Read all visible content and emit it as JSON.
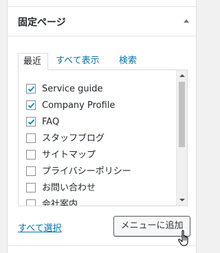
{
  "metabox": {
    "title": "固定ページ"
  },
  "tabs": [
    {
      "label": "最近"
    },
    {
      "label": "すべて表示"
    },
    {
      "label": "検索"
    }
  ],
  "items": [
    {
      "label": "Service guide",
      "checked": true
    },
    {
      "label": "Company Profile",
      "checked": true
    },
    {
      "label": "FAQ",
      "checked": true
    },
    {
      "label": "スタッフブログ",
      "checked": false
    },
    {
      "label": "サイトマップ",
      "checked": false
    },
    {
      "label": "プライバシーポリシー",
      "checked": false
    },
    {
      "label": "お問い合わせ",
      "checked": false
    },
    {
      "label": "会社案内",
      "checked": false
    }
  ],
  "footer": {
    "select_all": "すべて選択",
    "add_button": "メニューに追加"
  },
  "colors": {
    "link": "#0073aa",
    "check": "#1e8cbe"
  },
  "icons": {
    "toggle": "triangle-up-icon",
    "cursor": "hand-pointer-icon",
    "check": "checkmark-icon"
  }
}
